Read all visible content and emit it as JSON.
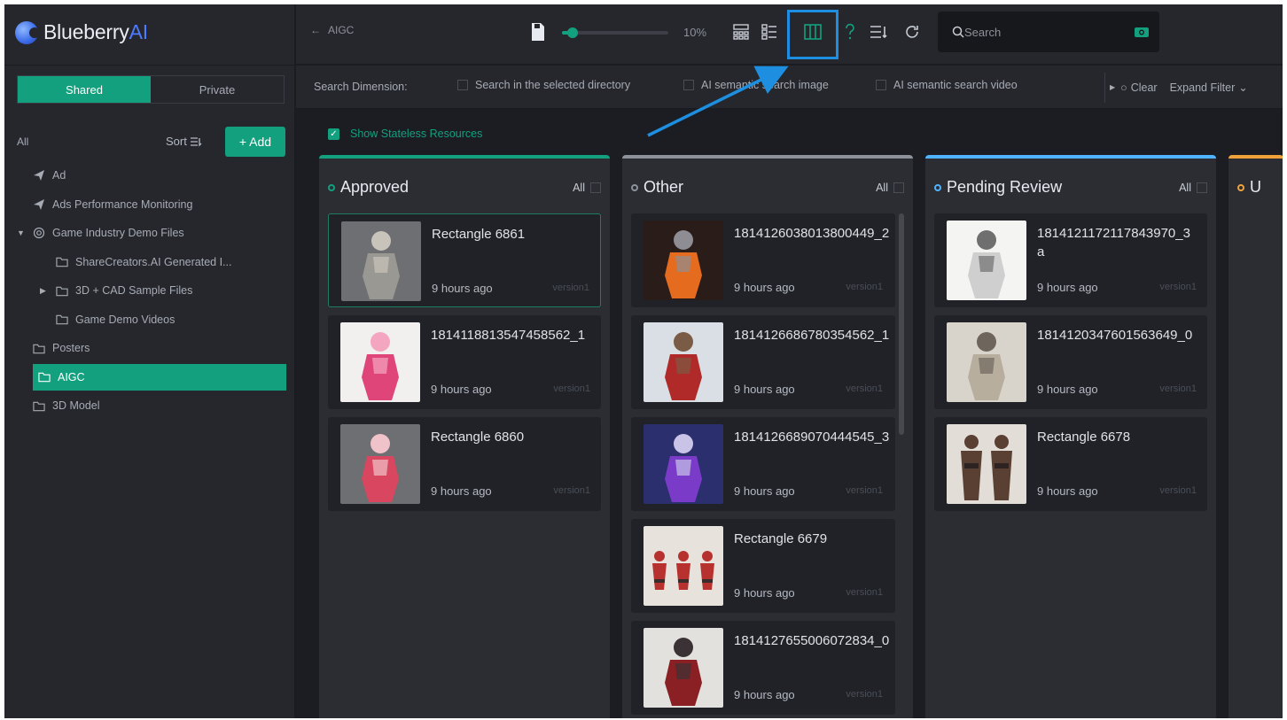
{
  "logo": {
    "brand": "Blueberry",
    "ai": "AI"
  },
  "sidebar": {
    "tabs": [
      {
        "label": "Shared",
        "active": true
      },
      {
        "label": "Private",
        "active": false
      }
    ],
    "all_label": "All",
    "sort_label": "Sort",
    "add_label": "+ Add",
    "items": [
      {
        "label": "Ad",
        "icon": "send-icon",
        "depth": 0,
        "caret": ""
      },
      {
        "label": "Ads Performance Monitoring",
        "icon": "send-icon",
        "depth": 0,
        "caret": ""
      },
      {
        "label": "Game Industry Demo Files",
        "icon": "globe-icon",
        "depth": 0,
        "caret": "expanded"
      },
      {
        "label": "ShareCreators.AI Generated I...",
        "icon": "folder-icon",
        "depth": 1,
        "caret": ""
      },
      {
        "label": "3D + CAD Sample Files",
        "icon": "folder-icon",
        "depth": 1,
        "caret": "collapsed"
      },
      {
        "label": "Game Demo Videos",
        "icon": "folder-icon",
        "depth": 1,
        "caret": ""
      },
      {
        "label": "Posters",
        "icon": "folder-icon",
        "depth": 0,
        "caret": ""
      },
      {
        "label": "AIGC",
        "icon": "folder-icon",
        "depth": 0,
        "caret": "",
        "selected": true
      },
      {
        "label": "3D Model",
        "icon": "folder-icon",
        "depth": 0,
        "caret": ""
      }
    ]
  },
  "topbar": {
    "breadcrumb": "AIGC",
    "zoom": "10%",
    "zoom_level": 0.1,
    "search_placeholder": "Search"
  },
  "filter": {
    "label": "Search Dimension:",
    "options": [
      "Search in the selected directory",
      "AI semantic search image",
      "AI semantic search video"
    ],
    "clear_label": "Clear",
    "expand_label": "Expand Filter"
  },
  "stateless_label": "Show Stateless Resources",
  "colors": {
    "accent": "#13a07e",
    "highlight": "#1e8fe0",
    "approved": "#13a07e",
    "other": "#8d919a",
    "pending": "#4fb3ff",
    "fourth": "#f0a23a"
  },
  "columns": [
    {
      "title": "Approved",
      "all_label": "All",
      "color": "#13a07e",
      "cards": [
        {
          "title": "Rectangle 6861",
          "time": "9 hours ago",
          "version": "version1",
          "thumb": "figure-grey-armor"
        },
        {
          "title": "1814118813547458562_1",
          "time": "9 hours ago",
          "version": "version1",
          "thumb": "figure-pink"
        },
        {
          "title": "Rectangle 6860",
          "time": "9 hours ago",
          "version": "version1",
          "thumb": "figure-pink-red"
        }
      ]
    },
    {
      "title": "Other",
      "all_label": "All",
      "color": "#8d919a",
      "cards": [
        {
          "title": "1814126038013800449_2",
          "time": "9 hours ago",
          "version": "version1",
          "thumb": "warrior-fire"
        },
        {
          "title": "1814126686780354562_1",
          "time": "9 hours ago",
          "version": "version1",
          "thumb": "warrior-red"
        },
        {
          "title": "1814126689070444545_3",
          "time": "9 hours ago",
          "version": "version1",
          "thumb": "mage-purple"
        },
        {
          "title": "Rectangle 6679",
          "time": "9 hours ago",
          "version": "version1",
          "thumb": "group-red"
        },
        {
          "title": "1814127655006072834_0",
          "time": "9 hours ago",
          "version": "version1",
          "thumb": "hooded-red"
        }
      ]
    },
    {
      "title": "Pending Review",
      "all_label": "All",
      "color": "#4fb3ff",
      "cards": [
        {
          "title": "1814121172117843970_3a",
          "time": "9 hours ago",
          "version": "version1",
          "thumb": "knight-white"
        },
        {
          "title": "1814120347601563649_0",
          "time": "9 hours ago",
          "version": "version1",
          "thumb": "knight-beige"
        },
        {
          "title": "Rectangle 6678",
          "time": "9 hours ago",
          "version": "version1",
          "thumb": "duo-dark"
        }
      ]
    },
    {
      "title": "U",
      "color": "#f0a23a",
      "cards": []
    }
  ]
}
